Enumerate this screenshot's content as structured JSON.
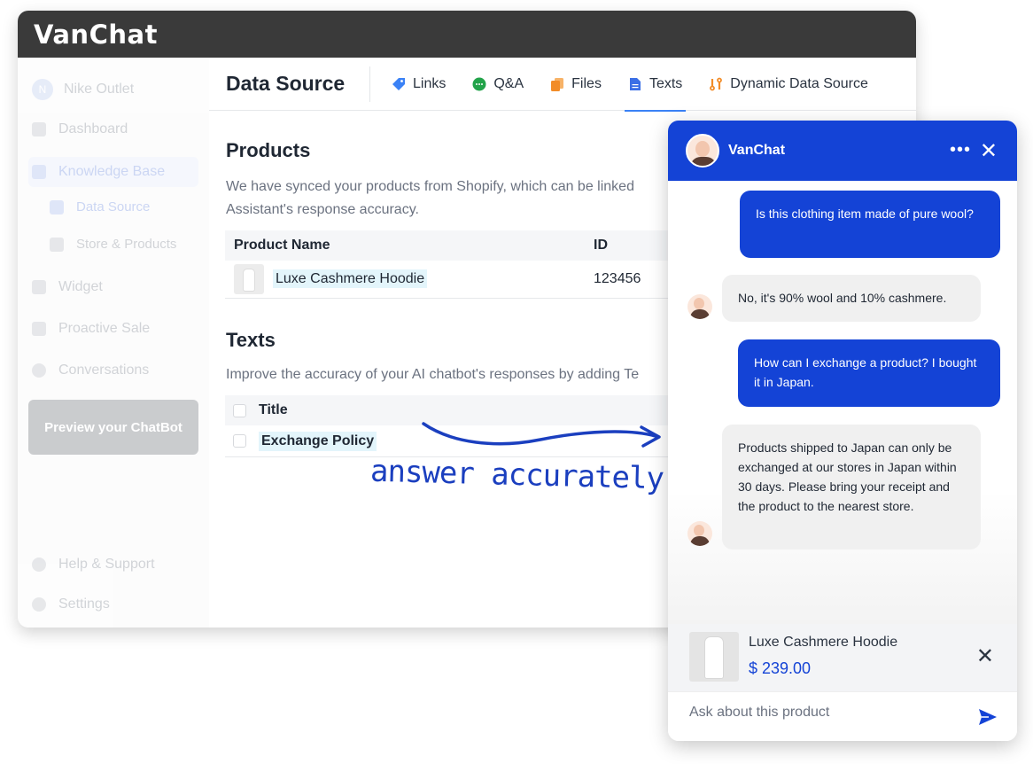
{
  "app": {
    "logo": "VanChat"
  },
  "sidebar": {
    "store": {
      "initial": "N",
      "name": "Nike Outlet"
    },
    "items": [
      {
        "label": "Dashboard"
      },
      {
        "label": "Knowledge Base"
      },
      {
        "label": "Data Source"
      },
      {
        "label": "Store & Products"
      },
      {
        "label": "Widget"
      },
      {
        "label": "Proactive Sale"
      },
      {
        "label": "Conversations"
      }
    ],
    "preview_button": "Preview your ChatBot",
    "help": "Help & Support",
    "settings": "Settings"
  },
  "header": {
    "title": "Data Source",
    "tabs": [
      {
        "label": "Links",
        "icon": "tag-icon",
        "color": "#3b82f6"
      },
      {
        "label": "Q&A",
        "icon": "chat-bubble-icon",
        "color": "#22a34a"
      },
      {
        "label": "Files",
        "icon": "files-icon",
        "color": "#f28c28"
      },
      {
        "label": "Texts",
        "icon": "document-icon",
        "color": "#3b6fe6"
      },
      {
        "label": "Dynamic Data Source",
        "icon": "dynamic-source-icon",
        "color": "#f28c28"
      }
    ],
    "active_tab": "Texts"
  },
  "products": {
    "title": "Products",
    "description_line1": "We have synced your products from Shopify, which can be linked",
    "description_line2": "Assistant's response accuracy.",
    "columns": [
      "Product Name",
      "ID"
    ],
    "rows": [
      {
        "name": "Luxe Cashmere Hoodie",
        "id": "123456"
      }
    ]
  },
  "texts": {
    "title": "Texts",
    "description": "Improve the accuracy of your AI chatbot's responses by adding Te",
    "columns": [
      "Title"
    ],
    "rows": [
      {
        "title": "Exchange Policy"
      }
    ]
  },
  "annotation": "answer accurately",
  "chat": {
    "name": "VanChat",
    "messages": [
      {
        "from": "user",
        "text": "Is this clothing item made of pure wool?"
      },
      {
        "from": "bot",
        "text": "No, it's 90% wool and 10% cashmere."
      },
      {
        "from": "user",
        "text": "How can I exchange a product? I bought it in Japan."
      },
      {
        "from": "bot",
        "text": "Products shipped to Japan can only be exchanged at our stores in Japan within 30 days. Please bring your receipt and the product to the nearest store."
      }
    ],
    "product": {
      "name": "Luxe Cashmere Hoodie",
      "price": "$ 239.00"
    },
    "input_placeholder": "Ask about this product"
  }
}
